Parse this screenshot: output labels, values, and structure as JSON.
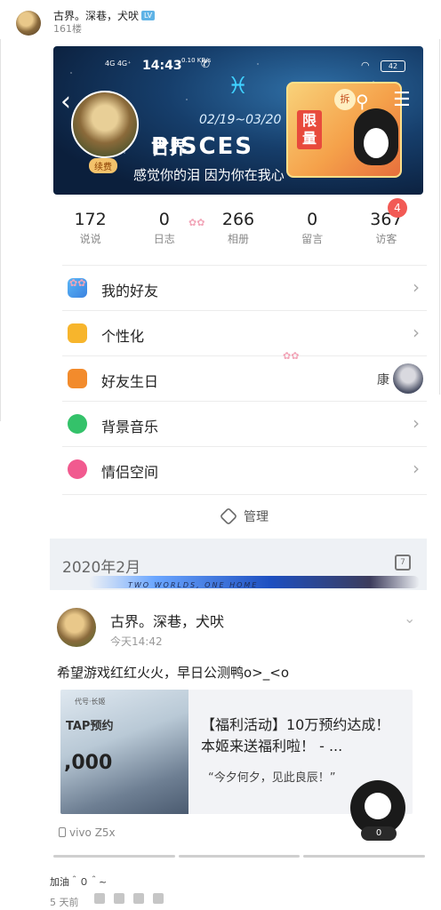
{
  "post": {
    "author": "古界。深巷，犬吠",
    "level_badge": "LV",
    "floor": "161楼"
  },
  "banner": {
    "status_time": "14:43",
    "status_network": "4G 4G⁺",
    "status_speed": "0.10 KB/s",
    "battery": "42",
    "date_range": "02/19~03/20",
    "zodiac_text": "PISCES",
    "profile_name": "古界",
    "slogan": "感觉你的泪 因为你在我心",
    "vip_tag": "续费",
    "limited_text": "限量",
    "chai": "拆"
  },
  "stats": [
    {
      "num": "172",
      "label": "说说"
    },
    {
      "num": "0",
      "label": "日志"
    },
    {
      "num": "266",
      "label": "相册"
    },
    {
      "num": "0",
      "label": "留言"
    },
    {
      "num": "367",
      "label": "访客"
    }
  ],
  "visitor_badge": "4",
  "menu": [
    {
      "label": "我的好友",
      "icon": "friends-icon"
    },
    {
      "label": "个性化",
      "icon": "personalize-icon"
    },
    {
      "label": "好友生日",
      "icon": "birthday-cake-icon",
      "extra": "康"
    },
    {
      "label": "背景音乐",
      "icon": "music-note-icon"
    },
    {
      "label": "情侣空间",
      "icon": "heart-icon"
    }
  ],
  "manage_label": "管理",
  "date_section": "2020年2月",
  "sword_text": "TWO WORLDS, ONE HOME",
  "feed": {
    "author": "古界。深巷，犬吠",
    "time": "今天14:42",
    "text": "希望游戏红红火火，早日公测鸭o>_<o",
    "card_title": "【福利活动】10万预约达成！本姬来送福利啦！ - ...",
    "card_subtitle": "“今夕何夕，见此良辰！”",
    "thumb_brand": "代号·长姬",
    "thumb_tap": "TAP预约",
    "thumb_num": ",000",
    "device": "vivo Z5x"
  },
  "float_count": "0",
  "reply": {
    "text": "加油＾０＾~",
    "time": "5 天前"
  }
}
